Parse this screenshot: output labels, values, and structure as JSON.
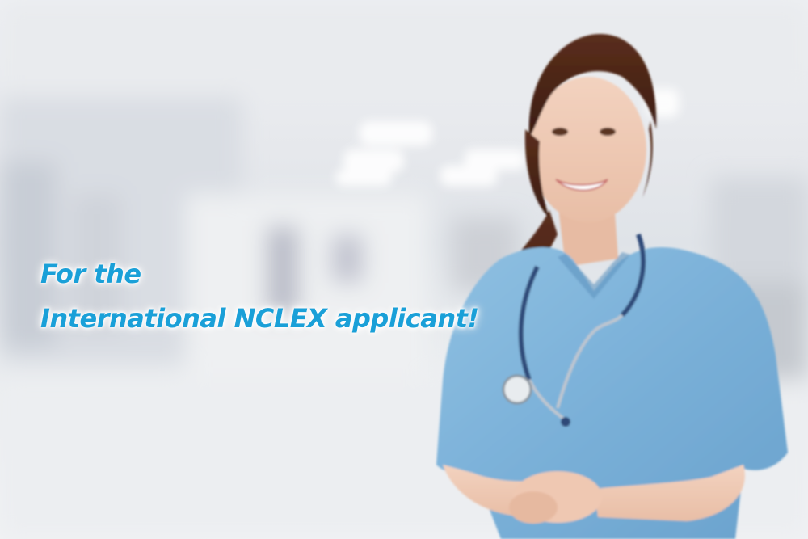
{
  "headline": {
    "line1": "For the",
    "line2": "International NCLEX applicant!"
  },
  "colors": {
    "headline_text": "#1aa0d8",
    "scrubs": "#7fb3d9",
    "background": "#e6e8ec"
  }
}
